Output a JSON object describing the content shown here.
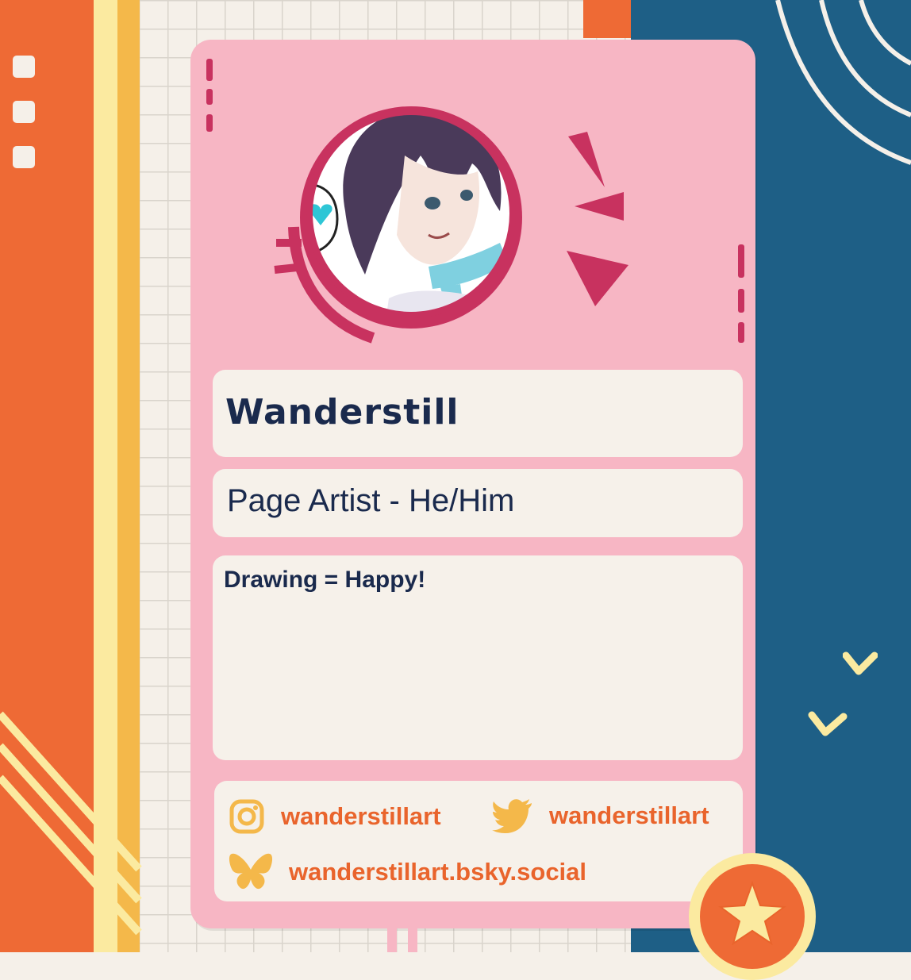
{
  "card": {
    "name": "Wanderstill",
    "role": "Page Artist - He/Him",
    "bio": "Drawing = Happy!"
  },
  "socials": {
    "instagram": {
      "handle": "wanderstillart",
      "icon": "instagram-icon"
    },
    "twitter": {
      "handle": "wanderstillart",
      "icon": "twitter-bird-icon"
    },
    "bluesky": {
      "handle": "wanderstillart.bsky.social",
      "icon": "bluesky-butterfly-icon"
    }
  },
  "colors": {
    "card_pink": "#f7b6c4",
    "accent_magenta": "#c8325f",
    "text_navy": "#1a2a4d",
    "social_orange": "#e9642c",
    "icon_gold": "#f4b84a",
    "bg_orange": "#ee6a35",
    "bg_blue": "#1e5f86",
    "panel_cream": "#f6f1ea"
  }
}
